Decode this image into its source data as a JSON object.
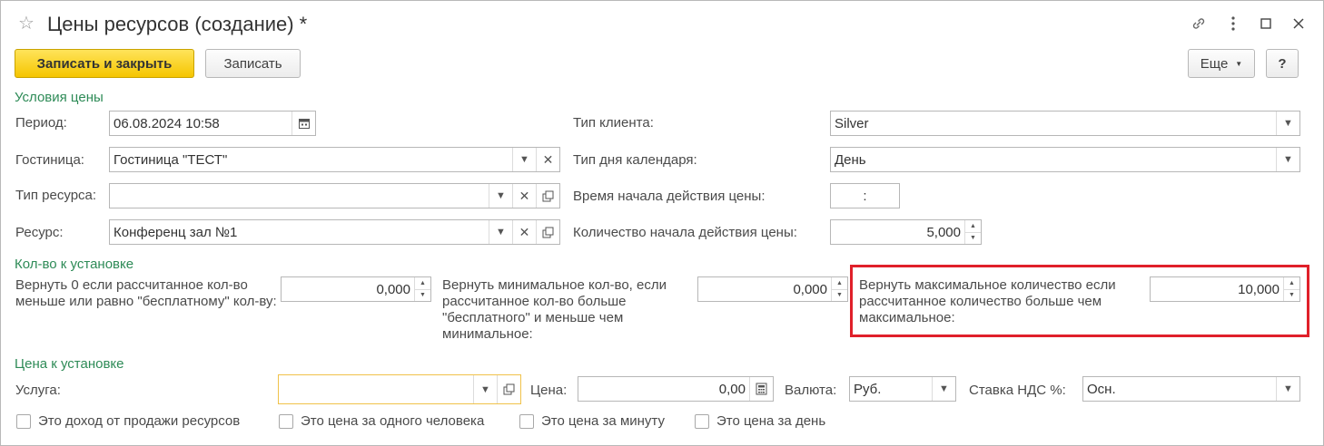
{
  "window": {
    "title": "Цены ресурсов (создание) *"
  },
  "toolbar": {
    "save_close_label": "Записать и закрыть",
    "save_label": "Записать",
    "more_label": "Еще",
    "help_label": "?"
  },
  "price_conditions": {
    "section_title": "Условия цены",
    "period_label": "Период:",
    "period_value": "06.08.2024 10:58",
    "hotel_label": "Гостиница:",
    "hotel_value": "Гостиница \"ТЕСТ\"",
    "resource_type_label": "Тип ресурса:",
    "resource_type_value": "",
    "resource_label": "Ресурс:",
    "resource_value": "Конференц зал №1",
    "client_type_label": "Тип клиента:",
    "client_type_value": "Silver",
    "day_type_label": "Тип дня календаря:",
    "day_type_value": "День",
    "start_time_label": "Время начала действия цены:",
    "start_time_value": ":",
    "start_qty_label": "Количество начала действия цены:",
    "start_qty_value": "5,000"
  },
  "quantity": {
    "section_title": "Кол-во к установке",
    "zero_label": "Вернуть 0 если рассчитанное кол-во меньше или равно \"бесплатному\" кол-ву:",
    "zero_value": "0,000",
    "min_label": "Вернуть минимальное кол-во, если рассчитанное кол-во больше \"бесплатного\" и меньше чем минимальное:",
    "min_value": "0,000",
    "max_label": "Вернуть максимальное количество если рассчитанное количество больше чем максимальное:",
    "max_value": "10,000"
  },
  "price": {
    "section_title": "Цена к установке",
    "service_label": "Услуга:",
    "service_value": "",
    "price_label": "Цена:",
    "price_value": "0,00",
    "currency_label": "Валюта:",
    "currency_value": "Руб.",
    "vat_label": "Ставка НДС %:",
    "vat_value": "Осн."
  },
  "checkboxes": [
    {
      "label": "Это доход от продажи ресурсов",
      "checked": false
    },
    {
      "label": "Это цена за одного человека",
      "checked": false
    },
    {
      "label": "Это цена за минуту",
      "checked": false
    },
    {
      "label": "Это цена за день",
      "checked": false
    }
  ],
  "colors": {
    "section_green": "#2e8b57",
    "primary_yellow": "#f5c500",
    "highlight_red": "#e0202a",
    "focus_border": "#f0c24a"
  }
}
